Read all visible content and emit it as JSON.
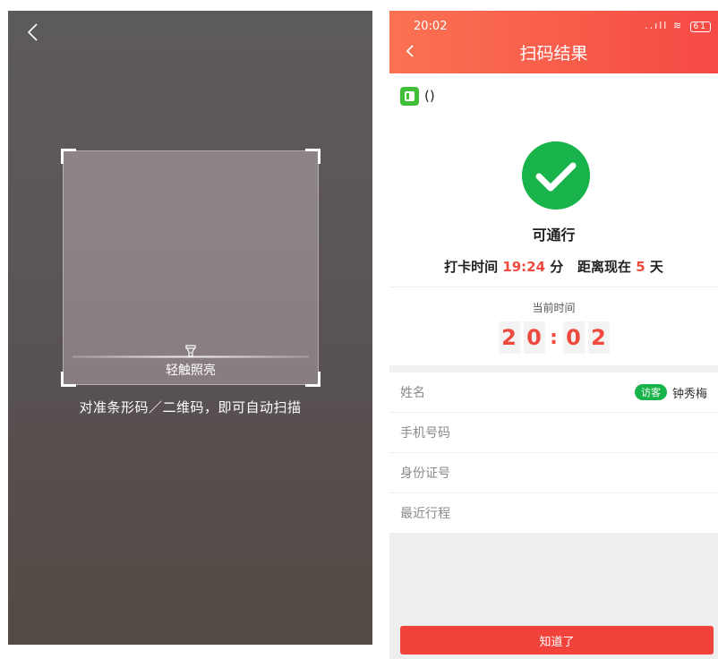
{
  "scanner": {
    "torch_label": "轻触照亮",
    "hint": "对准条形码／二维码，即可自动扫描"
  },
  "status_bar": {
    "time": "20:02",
    "signal": "..ıll",
    "battery": "61"
  },
  "header": {
    "title": "扫码结果"
  },
  "site": {
    "name": "()"
  },
  "result": {
    "status_text": "可通行",
    "checkin_label": "打卡时间",
    "checkin_time": "19:24",
    "minute_unit": "分",
    "distance_label": "距离现在",
    "days": "5",
    "days_unit": "天",
    "current_time_label": "当前时间",
    "current_time_digits": [
      "2",
      "0",
      "0",
      "2"
    ],
    "separator": ":"
  },
  "info": {
    "name_label": "姓名",
    "visitor_tag": "访客",
    "name_value": "钟秀梅",
    "phone_label": "手机号码",
    "id_label": "身份证号",
    "trip_label": "最近行程"
  },
  "actions": {
    "confirm_label": "知道了"
  },
  "colors": {
    "header_start": "#fb7252",
    "header_end": "#f54a45",
    "success_green": "#18b34a",
    "accent_red": "#f04a3f",
    "site_icon_green": "#41be38"
  }
}
